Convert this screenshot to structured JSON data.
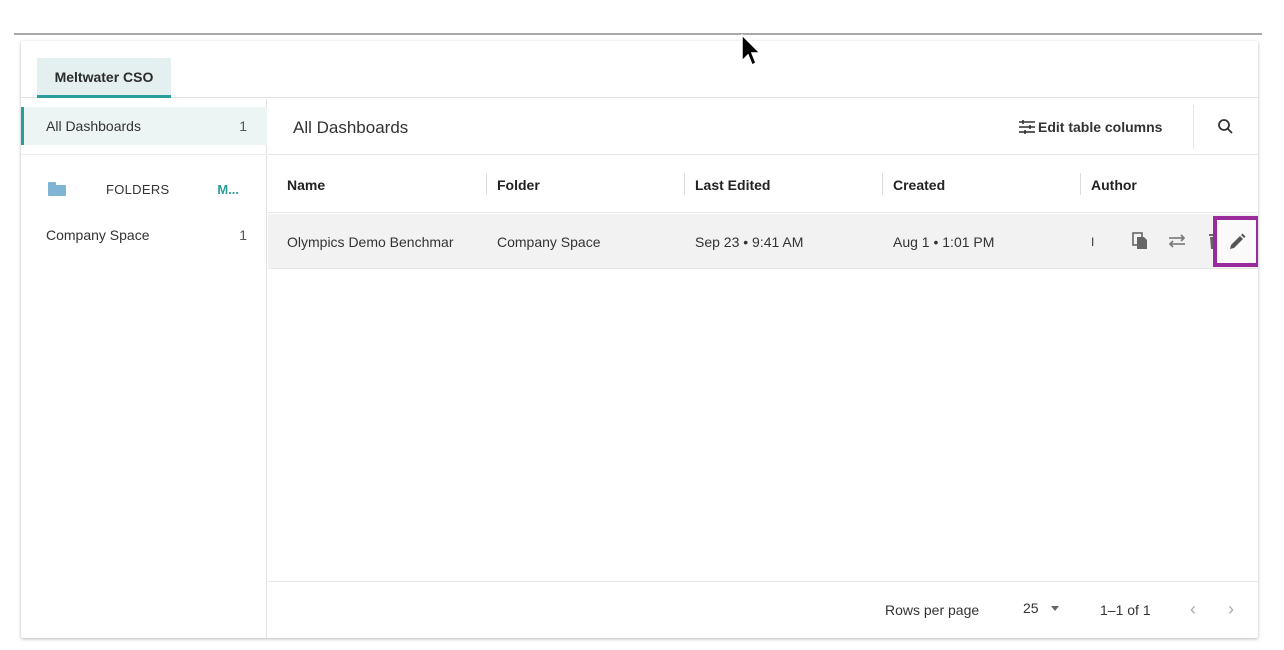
{
  "workspace_tab": "Meltwater CSO",
  "sidebar": {
    "all_dashboards": {
      "label": "All Dashboards",
      "count": "1"
    },
    "folders": {
      "label": "FOLDERS",
      "action": "M..."
    },
    "items": [
      {
        "label": "Company Space",
        "count": "1"
      }
    ]
  },
  "main": {
    "title": "All Dashboards",
    "edit_columns_label": "Edit table columns",
    "columns": [
      "Name",
      "Folder",
      "Last Edited",
      "Created",
      "Author"
    ],
    "rows": [
      {
        "name": "Olympics Demo Benchmar",
        "folder": "Company Space",
        "last_edited": "Sep 23 • 9:41 AM",
        "created": "Aug 1 • 1:01 PM",
        "author": "I"
      }
    ]
  },
  "footer": {
    "rows_per_page_label": "Rows per page",
    "rows_per_page_value": "25",
    "range": "1–1 of 1",
    "prev": "‹",
    "next": "›"
  },
  "colors": {
    "accent": "#2a9d9a",
    "highlight_box": "#9b2a9b",
    "folder_icon": "#7fb4d4"
  }
}
